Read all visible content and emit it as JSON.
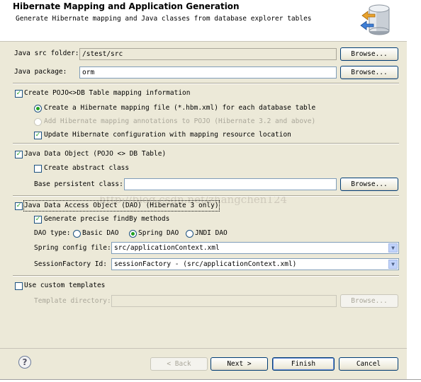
{
  "header": {
    "title": "Hibernate Mapping and Application Generation",
    "description": "Generate Hibernate mapping and Java classes from database explorer tables",
    "icon": "database-conversion-icon"
  },
  "src_folder": {
    "label": "Java src folder:",
    "value": "/stest/src",
    "browse_label": "Browse..."
  },
  "package": {
    "label": "Java package:",
    "value": "orm",
    "browse_label": "Browse..."
  },
  "pojo_db": {
    "label": "Create POJO<>DB Table mapping information",
    "checked": true,
    "mapping_file": {
      "label": "Create a Hibernate mapping file (*.hbm.xml) for each database table",
      "selected": true
    },
    "annotations": {
      "label": "Add Hibernate mapping annotations to POJO (Hibernate 3.2 and above)",
      "selected": false,
      "enabled": false
    },
    "update_config": {
      "label": "Update Hibernate configuration with mapping resource location",
      "checked": true
    }
  },
  "java_data_object": {
    "label": "Java Data Object (POJO <> DB Table)",
    "checked": true,
    "abstract_class": {
      "label": "Create abstract class",
      "checked": false
    },
    "base_class": {
      "label": "Base persistent class:",
      "value": "",
      "browse_label": "Browse..."
    }
  },
  "dao": {
    "label": "Java Data Access Object (DAO) (Hibernate 3 only)",
    "checked": true,
    "precise_findby": {
      "label": "Generate precise findBy methods",
      "checked": true
    },
    "type_label": "DAO type:",
    "types": [
      {
        "label": "Basic DAO",
        "selected": false
      },
      {
        "label": "Spring DAO",
        "selected": true
      },
      {
        "label": "JNDI DAO",
        "selected": false
      }
    ],
    "spring_config": {
      "label": "Spring config file:",
      "value": "src/applicationContext.xml"
    },
    "session_factory": {
      "label": "SessionFactory Id:",
      "value": "sessionFactory - (src/applicationContext.xml)"
    }
  },
  "custom_templates": {
    "label": "Use custom templates",
    "checked": false,
    "dir_label": "Template directory:",
    "dir_value": "",
    "browse_label": "Browse..."
  },
  "watermark": "http://blog.csdn.net/zhangchen124",
  "footer": {
    "help_icon": "help-icon",
    "back_label": "< Back",
    "next_label": "Next >",
    "finish_label": "Finish",
    "cancel_label": "Cancel"
  },
  "colors": {
    "dialog_bg": "#ece9d8",
    "check_green": "#21a121",
    "button_border": "#003c74",
    "input_border": "#7f9db9"
  }
}
